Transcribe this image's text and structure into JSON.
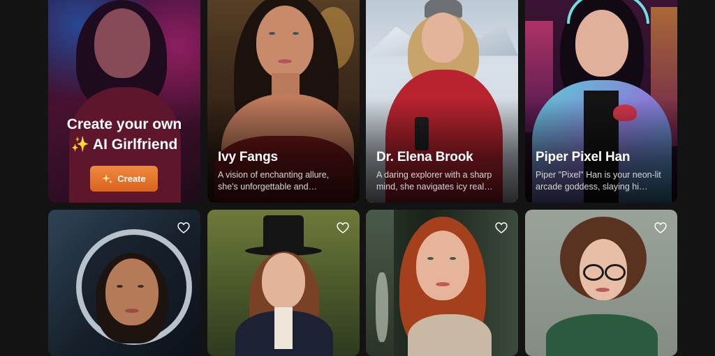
{
  "promo": {
    "line1": "Create your own",
    "line2_icon": "✨",
    "line2": "AI Girlfriend",
    "button_label": "Create"
  },
  "characters": [
    {
      "name": "Ivy Fangs",
      "desc_line1": "A vision of enchanting allure,",
      "desc_line2": "she's unforgettable and…"
    },
    {
      "name": "Dr. Elena Brook",
      "desc_line1": "A daring explorer with a sharp",
      "desc_line2": "mind, she navigates icy real…"
    },
    {
      "name": "Piper Pixel Han",
      "desc_line1": "Piper \"Pixel\" Han is your neon-lit",
      "desc_line2": "arcade goddess, slaying hi…"
    }
  ],
  "icons": {
    "favorite": "heart-outline-icon",
    "create": "sparkles-icon"
  },
  "colors": {
    "page_background": "#131313",
    "create_button": "#e8782f",
    "card_text": "#ffffff"
  }
}
